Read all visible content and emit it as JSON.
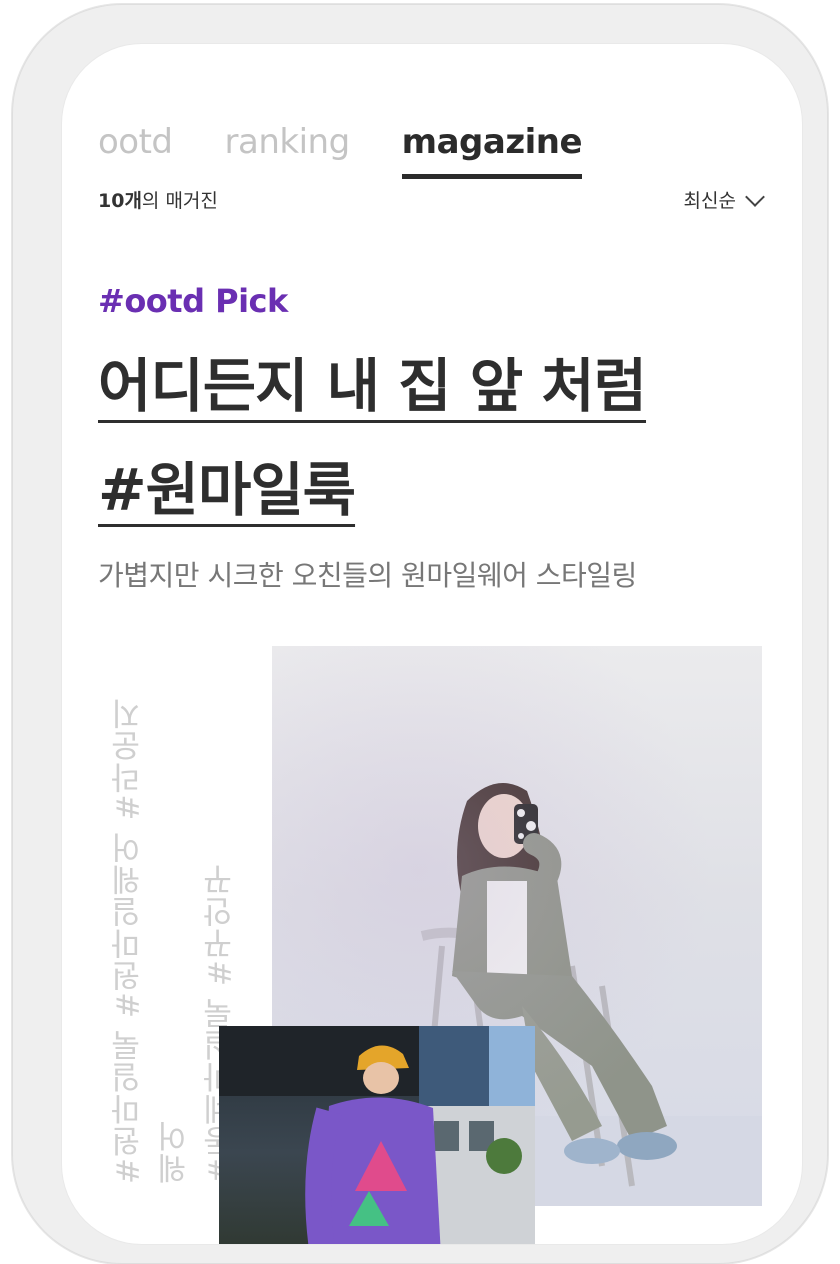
{
  "tabs": [
    {
      "label": "ootd",
      "active": false
    },
    {
      "label": "ranking",
      "active": false
    },
    {
      "label": "magazine",
      "active": true
    }
  ],
  "magazine_count": {
    "number": "10개",
    "suffix": "의 매거진"
  },
  "sort": {
    "label": "최신순",
    "icon": "chevron-down-icon"
  },
  "article": {
    "hashtag": "#ootd Pick",
    "title_line1": "어디든지 내 집 앞 처럼",
    "title_line2": "#원마일룩",
    "subtitle": "가볍지만 시크한 오친들의 원마일웨어 스타일링",
    "tags_line1": "#원마일룩 #원마일웨어 #라운지웨어",
    "tags_line2": "#동네마실룩 #꾸안꾸"
  },
  "colors": {
    "accent": "#6a2fb2",
    "text": "#2e2e2e",
    "muted": "#777777"
  }
}
